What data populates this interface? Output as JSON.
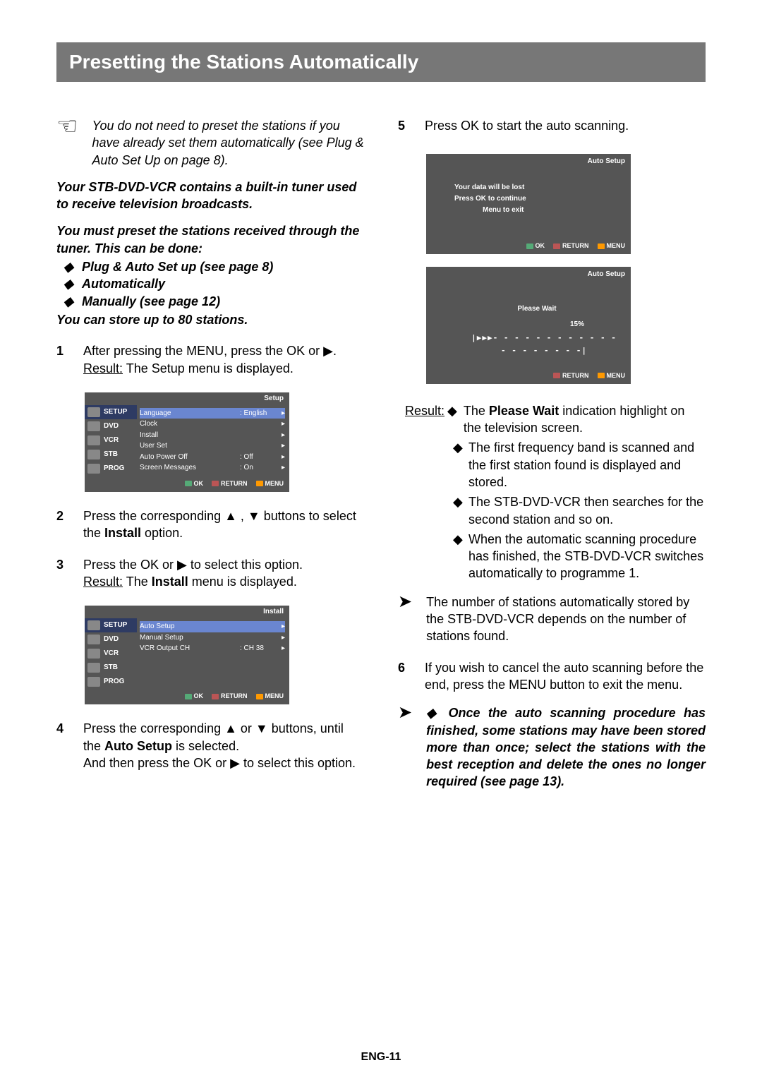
{
  "title": "Presetting the Stations Automatically",
  "note": "You do not need to preset the stations if you have already set them automatically (see Plug & Auto Set Up on page 8).",
  "intro1": "Your STB-DVD-VCR contains a built-in tuner used to receive television broadcasts.",
  "intro2": "You must preset the stations received through the tuner. This can be done:",
  "methods": [
    "Plug & Auto Set up (see page 8)",
    "Automatically",
    "Manually (see page 12)"
  ],
  "storeNote": "You can store up to 80 stations.",
  "steps": {
    "s1": {
      "num": "1",
      "text_a": "After pressing the MENU, press the OK or ▶.",
      "result_label": "Result:",
      "result": " The Setup menu is displayed."
    },
    "s2": {
      "num": "2",
      "text_a": "Press the corresponding  ▲ , ▼  buttons to select the ",
      "bold": "Install",
      "text_b": " option."
    },
    "s3": {
      "num": "3",
      "text_a": "Press the OK or ▶ to select this option.",
      "result_label": "Result:",
      "result_a": " The ",
      "result_bold": "Install",
      "result_b": " menu is displayed."
    },
    "s4": {
      "num": "4",
      "text_a": "Press the corresponding  ▲ or ▼  buttons, until the ",
      "bold": "Auto Setup",
      "text_b": " is selected.",
      "text_c": "And then press the OK or ▶ to select this option."
    },
    "s5": {
      "num": "5",
      "text": "Press OK to start the auto scanning."
    },
    "s6": {
      "num": "6",
      "text": "If you wish to cancel the auto scanning before the end, press the MENU button to exit the menu."
    }
  },
  "osd_setup": {
    "header": "Setup",
    "side": [
      "SETUP",
      "DVD",
      "VCR",
      "STB",
      "PROG"
    ],
    "rows": [
      {
        "label": "Language",
        "value": ": English"
      },
      {
        "label": "Clock",
        "value": ""
      },
      {
        "label": "Install",
        "value": ""
      },
      {
        "label": "User Set",
        "value": ""
      },
      {
        "label": "Auto Power Off",
        "value": ": Off"
      },
      {
        "label": "Screen Messages",
        "value": ": On"
      }
    ],
    "footer": [
      "OK",
      "RETURN",
      "MENU"
    ]
  },
  "osd_install": {
    "header": "Install",
    "side": [
      "SETUP",
      "DVD",
      "VCR",
      "STB",
      "PROG"
    ],
    "rows": [
      {
        "label": "Auto Setup",
        "value": ""
      },
      {
        "label": "Manual Setup",
        "value": ""
      },
      {
        "label": "VCR Output CH",
        "value": ": CH 38"
      }
    ],
    "footer": [
      "OK",
      "RETURN",
      "MENU"
    ]
  },
  "osd_as1": {
    "header": "Auto Setup",
    "line1": "Your data will be lost",
    "line2": "Press   OK   to continue",
    "line3": "Menu    to exit",
    "footer": [
      "OK",
      "RETURN",
      "MENU"
    ]
  },
  "osd_as2": {
    "header": "Auto Setup",
    "wait": "Please Wait",
    "pct": "15%",
    "dashes": "|▶▶▶- - - - - - - - - - - - - - - - - - - -|",
    "footer": [
      "RETURN",
      "MENU"
    ]
  },
  "result5": {
    "label": "Result:",
    "first_pre": "The ",
    "first_bold": "Please Wait",
    "first_post": " indication highlight on the television screen.",
    "items": [
      "The first frequency band is scanned and the first station found is displayed and stored.",
      "The STB-DVD-VCR then searches for the second station and so on.",
      "When the automatic scanning procedure has finished, the STB-DVD-VCR switches automatically to programme 1."
    ]
  },
  "afterResultNote": "The number of stations automatically stored by the STB-DVD-VCR depends on the number of stations found.",
  "finalNote": "Once the auto scanning procedure has finished, some stations may have been stored more than once; select the stations with the best reception and delete the ones no longer required (see page 13).",
  "footer": "ENG-11"
}
